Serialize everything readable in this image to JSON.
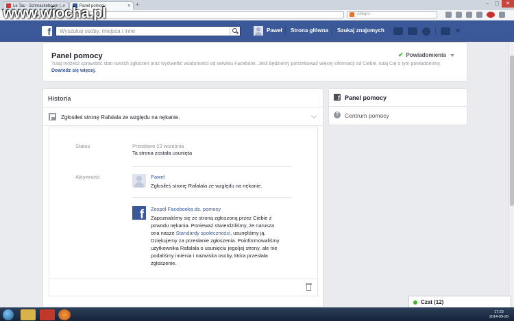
{
  "browser": {
    "tabs": [
      {
        "label": "Le Tac - Schmackeboom (..."
      },
      {
        "label": "Panel pomocy",
        "active": true
      }
    ],
    "search_placeholder": "Allegro"
  },
  "watermark": "www.wiocha.pl",
  "fb": {
    "search_placeholder": "Wyszukaj osoby, miejsca i inne",
    "nav": {
      "user": "Paweł",
      "home": "Strona główna",
      "find_friends": "Szukaj znajomych"
    }
  },
  "header": {
    "title": "Panel pomocy",
    "desc": "Tutaj możesz sprawdzić stan swoich zgłoszeń oraz wyświetlić wiadomości od serwisu Facebook. Jeśli będziemy potrzebować więcej informacji od Ciebie, tutaj Cię o tym powiadomimy.",
    "more_link": "Dowiedz się więcej.",
    "notifications": "Powiadomienia"
  },
  "history": {
    "title": "Historia",
    "report_title": "Zgłosiłeś stronę Rafalala ze względu na nękanie.",
    "status_label": "Status",
    "status_date": "Przesłano 23 września",
    "status_value": "Ta strona została usunięta",
    "activity_label": "Aktywność",
    "activity": [
      {
        "author": "Paweł",
        "text": "Zgłosiłeś stronę Rafalala ze względu na nękanie."
      },
      {
        "author": "Zespół Facebooka ds. pomocy",
        "lines": [
          "Zapoznaliśmy się ze stroną zgłoszoną przez Ciebie z",
          "powodu nękania. Ponieważ stwierdziliśmy, że narusza",
          "ona nasze",
          "Standardy społeczności",
          ", usunęliśmy ją.",
          "Dziękujemy za przesłanie zgłoszenia. Poinformowaliśmy",
          "użytkownika Rafalala o usunięciu jego/jej strony, ale nie",
          "podaliśmy imienia i nazwiska osoby, która przesłała",
          "zgłoszenie."
        ]
      }
    ]
  },
  "sidebar": {
    "title": "Panel pomocy",
    "items": [
      {
        "label": "Centrum pomocy"
      }
    ]
  },
  "chat": {
    "label": "Czat (12)"
  },
  "taskbar": {
    "time": "17:23",
    "date": "2014-09-28"
  }
}
